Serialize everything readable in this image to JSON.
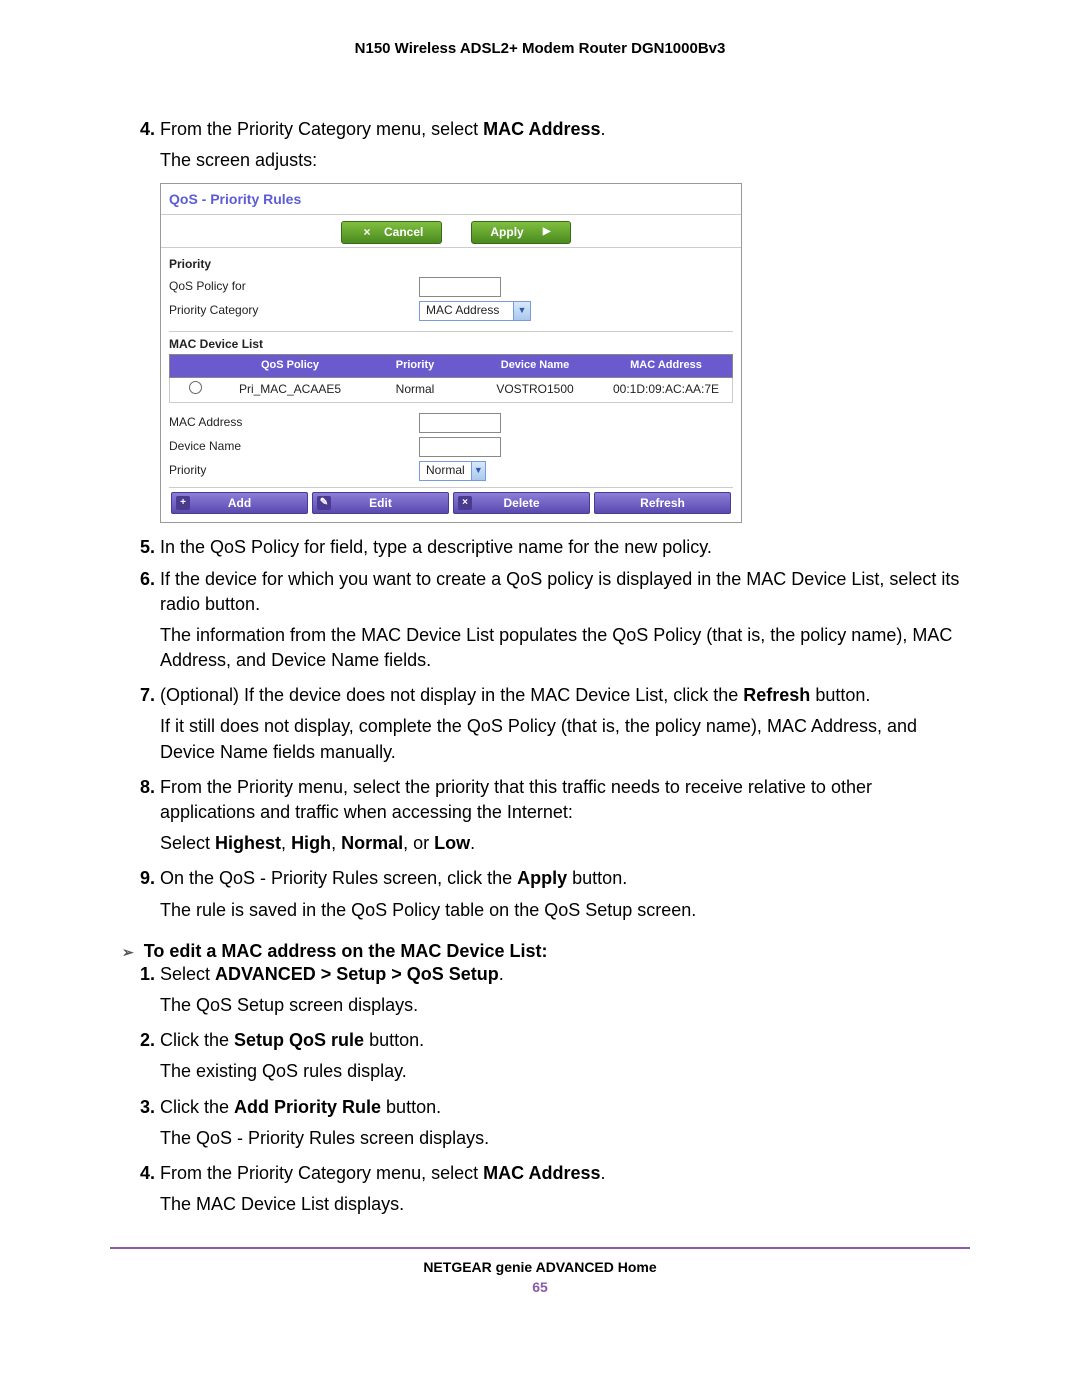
{
  "doc_title": "N150 Wireless ADSL2+ Modem Router DGN1000Bv3",
  "steps_a": {
    "s4": {
      "text_a": "From the Priority Category menu, select ",
      "bold": "MAC Address",
      "text_b": ".",
      "sub": "The screen adjusts:"
    },
    "s5": "In the QoS Policy for field, type a descriptive name for the new policy.",
    "s6": {
      "text": "If the device for which you want to create a QoS policy is displayed in the MAC Device List, select its radio button.",
      "sub": "The information from the MAC Device List populates the QoS Policy (that is, the policy name), MAC Address, and Device Name fields."
    },
    "s7": {
      "text_a": "(Optional) If the device does not display in the MAC Device List, click the ",
      "bold": "Refresh",
      "text_b": " button.",
      "sub": "If it still does not display, complete the QoS Policy (that is, the policy name), MAC Address, and Device Name fields manually."
    },
    "s8": {
      "text": "From the Priority menu, select the priority that this traffic needs to receive relative to other applications and traffic when accessing the Internet:",
      "sub_a": "Select ",
      "sub_bold_1": "Highest",
      "sub_c": ", ",
      "sub_bold_2": "High",
      "sub_e": ", ",
      "sub_bold_3": "Normal",
      "sub_g": ", or ",
      "sub_bold_4": "Low",
      "sub_i": "."
    },
    "s9": {
      "text_a": "On the QoS - Priority Rules screen, click the ",
      "bold": "Apply",
      "text_b": " button.",
      "sub": "The rule is saved in the QoS Policy table on the QoS Setup screen."
    }
  },
  "subsection_title": "To edit a MAC address on the MAC Device List:",
  "steps_b": {
    "s1": {
      "text_a": "Select ",
      "bold": "ADVANCED > Setup > QoS Setup",
      "text_b": ".",
      "sub": "The QoS Setup screen displays."
    },
    "s2": {
      "text_a": "Click the ",
      "bold": "Setup QoS rule",
      "text_b": " button.",
      "sub": "The existing QoS rules display."
    },
    "s3": {
      "text_a": "Click the ",
      "bold": "Add Priority Rule",
      "text_b": " button.",
      "sub": "The QoS - Priority Rules screen displays."
    },
    "s4": {
      "text_a": "From the Priority Category menu, select ",
      "bold": "MAC Address",
      "text_b": ".",
      "sub": "The MAC Device List displays."
    }
  },
  "screenshot": {
    "title": "QoS - Priority Rules",
    "btn_cancel": "Cancel",
    "btn_apply": "Apply",
    "lbl_priority_section": "Priority",
    "lbl_qos_policy_for": "QoS Policy for",
    "lbl_priority_category": "Priority Category",
    "sel_priority_category": "MAC Address",
    "lbl_mac_device_list": "MAC Device List",
    "thead": {
      "policy": "QoS Policy",
      "priority": "Priority",
      "devname": "Device Name",
      "mac": "MAC Address"
    },
    "trow": {
      "policy": "Pri_MAC_ACAAE5",
      "priority": "Normal",
      "devname": "VOSTRO1500",
      "mac": "00:1D:09:AC:AA:7E"
    },
    "lbl_mac_address": "MAC Address",
    "lbl_device_name": "Device Name",
    "lbl_priority": "Priority",
    "sel_priority": "Normal",
    "btn_add": "Add",
    "btn_edit": "Edit",
    "btn_delete": "Delete",
    "btn_refresh": "Refresh"
  },
  "footer": {
    "text": "NETGEAR genie ADVANCED Home",
    "page": "65"
  }
}
